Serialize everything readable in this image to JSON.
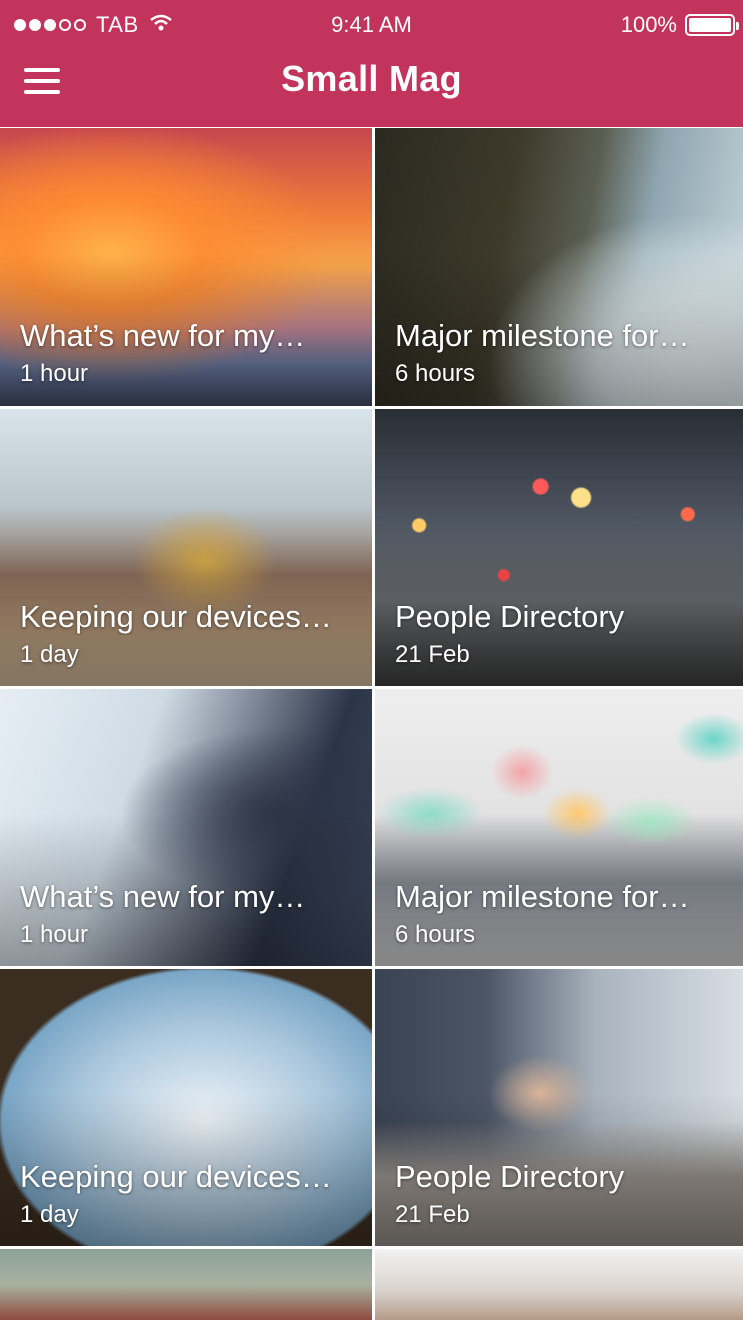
{
  "status_bar": {
    "carrier": "TAB",
    "time": "9:41 AM",
    "battery": "100%"
  },
  "header": {
    "title": "Small Mag"
  },
  "accent_color": "#c2345c",
  "cards": [
    {
      "title": "What’s new for my…",
      "time": "1 hour",
      "image": "sunset-sky"
    },
    {
      "title": "Major milestone for…",
      "time": "6 hours",
      "image": "rocky-coast"
    },
    {
      "title": "Keeping our devices…",
      "time": "1 day",
      "image": "office-lunch"
    },
    {
      "title": "People Directory",
      "time": "21 Feb",
      "image": "string-lights"
    },
    {
      "title": "What’s new for my…",
      "time": "1 hour",
      "image": "business-men-tablet"
    },
    {
      "title": "Major milestone for…",
      "time": "6 hours",
      "image": "speech-bubbles"
    },
    {
      "title": "Keeping our devices…",
      "time": "1 day",
      "image": "plane-window"
    },
    {
      "title": "People Directory",
      "time": "21 Feb",
      "image": "man-on-phone"
    },
    {
      "title": "",
      "time": "",
      "image": "person-red-cap"
    },
    {
      "title": "",
      "time": "",
      "image": "team-meeting"
    }
  ]
}
